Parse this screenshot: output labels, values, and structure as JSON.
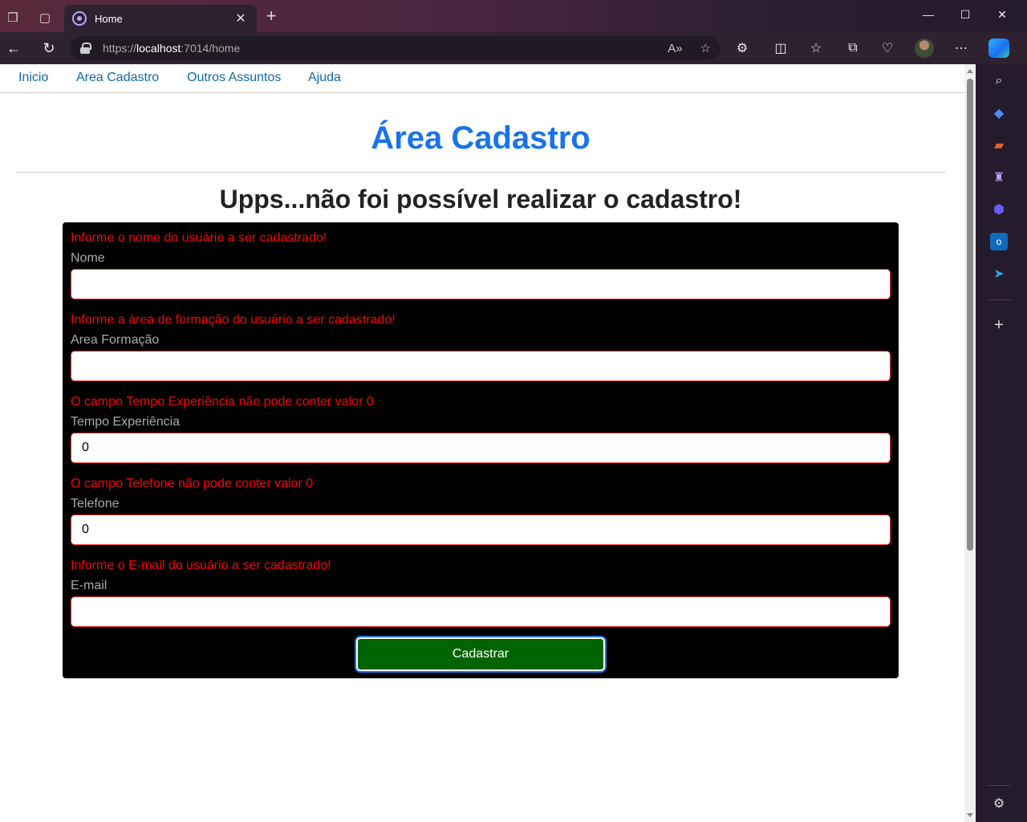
{
  "browser": {
    "tab_title": "Home",
    "url_scheme": "https://",
    "url_host": "localhost",
    "url_rest": ":7014/home"
  },
  "site_nav": {
    "items": [
      "Inicio",
      "Area Cadastro",
      "Outros Assuntos",
      "Ajuda"
    ]
  },
  "page": {
    "title": "Área Cadastro",
    "error_heading": "Upps...não foi possível realizar o cadastro!"
  },
  "form": {
    "fields": [
      {
        "error": "Informe o nome do usuário a ser cadastrado!",
        "label": "Nome",
        "value": ""
      },
      {
        "error": "Informe a área de formação do usuário a ser cadastrado!",
        "label": "Area Formação",
        "value": ""
      },
      {
        "error": "O campo Tempo Experiência não pode conter valor 0",
        "label": "Tempo Experiência",
        "value": "0"
      },
      {
        "error": "O campo Telefone não pode conter valor 0",
        "label": "Telefone",
        "value": "0"
      },
      {
        "error": "Informe o E-mail do usuário a ser cadastrado!",
        "label": "E-mail",
        "value": ""
      }
    ],
    "submit_label": "Cadastrar"
  },
  "colors": {
    "error_text": "#ff0000",
    "title": "#1a73e8",
    "form_bg": "#000000",
    "submit_bg": "#006400"
  }
}
